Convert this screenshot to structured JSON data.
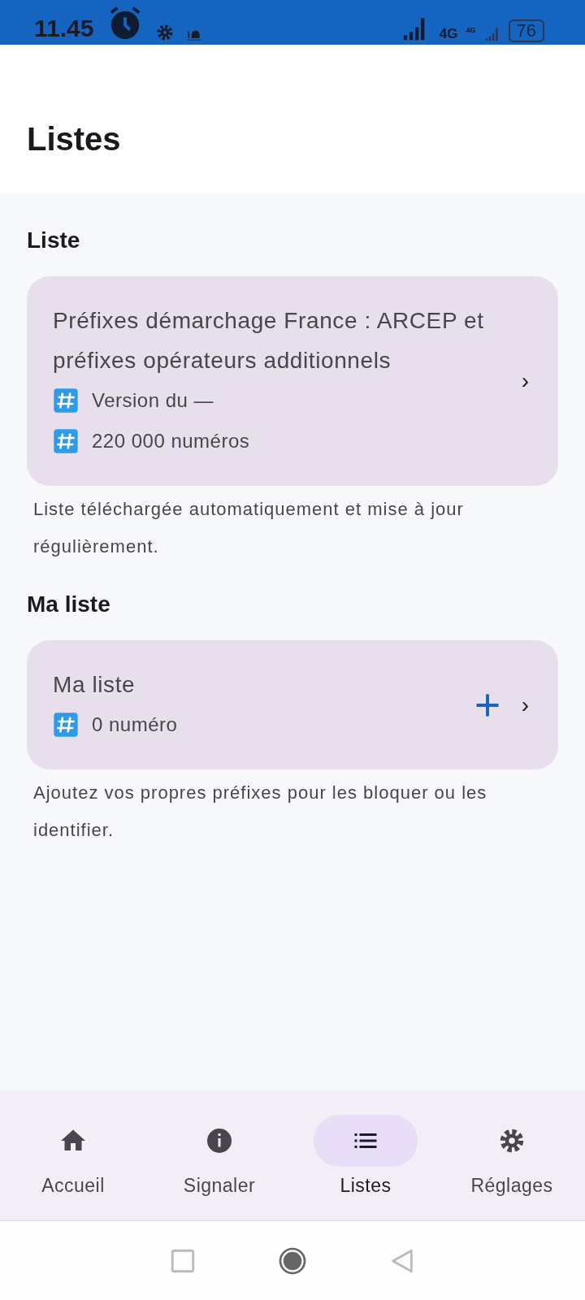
{
  "status_bar": {
    "time": "11.45",
    "network": "4G",
    "network_small": "4G",
    "battery": "76"
  },
  "header": {
    "title": "Listes"
  },
  "sections": [
    {
      "heading": "Liste",
      "card": {
        "title": "Préfixes démarchage France : ARCEP et préfixes opérateurs additionnels",
        "lines": [
          "Version du —",
          "220 000 numéros"
        ],
        "has_add": false,
        "chevron": "›"
      },
      "note": "Liste téléchargée automatiquement et mise à jour régulièrement."
    },
    {
      "heading": "Ma liste",
      "card": {
        "title": "Ma liste",
        "lines": [
          "0 numéro"
        ],
        "has_add": true,
        "chevron": "›"
      },
      "note": "Ajoutez vos propres préfixes pour les bloquer ou les identifier."
    }
  ],
  "bottom_nav": [
    {
      "kind": "home",
      "label": "Accueil",
      "selected": false
    },
    {
      "kind": "info",
      "label": "Signaler",
      "selected": false
    },
    {
      "kind": "list",
      "label": "Listes",
      "selected": true
    },
    {
      "kind": "settings",
      "label": "Réglages",
      "selected": false
    }
  ]
}
